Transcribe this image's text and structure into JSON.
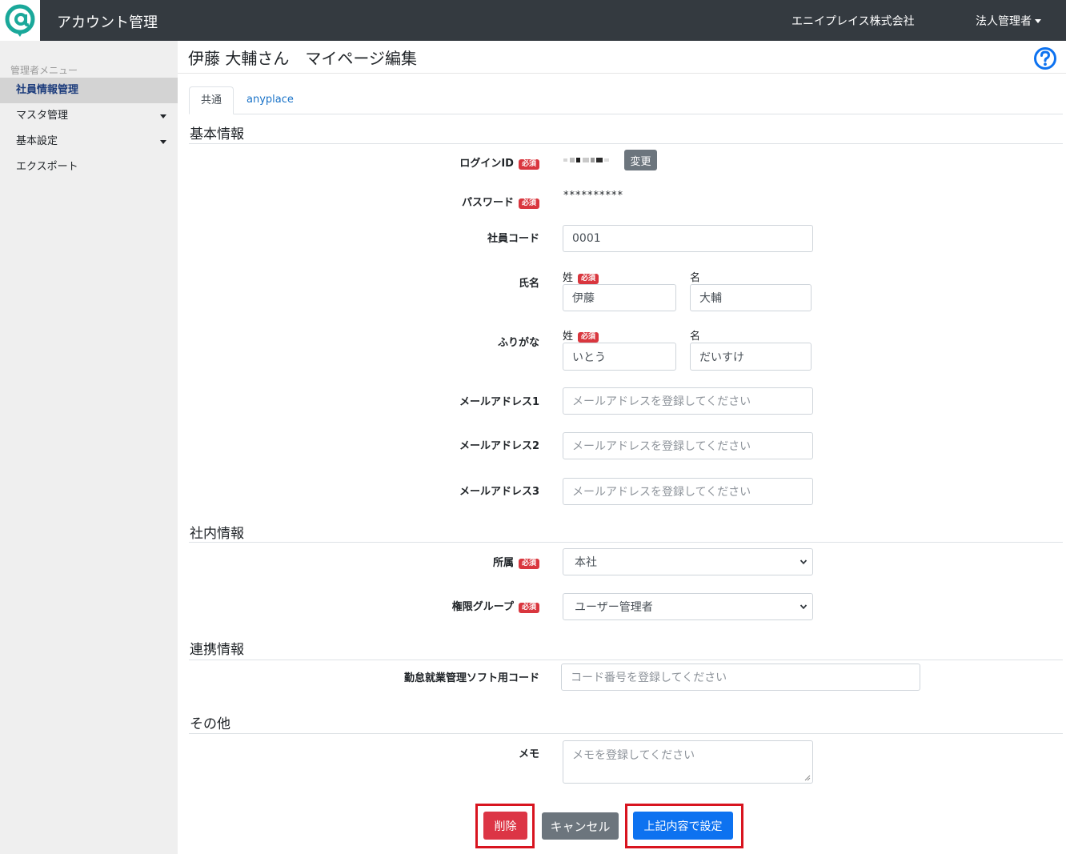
{
  "header": {
    "app_title": "アカウント管理",
    "company": "エニイプレイス株式会社",
    "user_menu": "法人管理者",
    "logo_icon": "at-sign-logo-icon",
    "accent": "#343a40"
  },
  "sidebar": {
    "heading": "管理者メニュー",
    "items": [
      {
        "label": "社員情報管理",
        "active": true
      },
      {
        "label": "マスタ管理",
        "has_dropdown": true
      },
      {
        "label": "基本設定",
        "has_dropdown": true
      },
      {
        "label": "エクスポート"
      }
    ]
  },
  "page": {
    "title": "伊藤 大輔さん　マイページ編集",
    "help_icon": "question-circle-icon"
  },
  "tabs": [
    {
      "label": "共通",
      "active": true
    },
    {
      "label": "anyplace",
      "active": false
    }
  ],
  "required_badge": "必須",
  "sections": {
    "basic": "基本情報",
    "internal": "社内情報",
    "integration": "連携情報",
    "other": "その他"
  },
  "fields": {
    "login_id": {
      "label": "ログインID",
      "change_button": "変更"
    },
    "password": {
      "label": "パスワード",
      "value": "**********"
    },
    "employee_code": {
      "label": "社員コード",
      "value": "0001"
    },
    "name": {
      "label": "氏名",
      "last_label": "姓",
      "first_label": "名",
      "last_value": "伊藤",
      "first_value": "大輔"
    },
    "furigana": {
      "label": "ふりがな",
      "last_label": "姓",
      "first_label": "名",
      "last_value": "いとう",
      "first_value": "だいすけ"
    },
    "email1": {
      "label": "メールアドレス1",
      "placeholder": "メールアドレスを登録してください"
    },
    "email2": {
      "label": "メールアドレス2",
      "placeholder": "メールアドレスを登録してください"
    },
    "email3": {
      "label": "メールアドレス3",
      "placeholder": "メールアドレスを登録してください"
    },
    "affiliation": {
      "label": "所属",
      "value": "本社"
    },
    "permission_group": {
      "label": "権限グループ",
      "value": "ユーザー管理者"
    },
    "attendance_code": {
      "label": "勤怠就業管理ソフト用コード",
      "placeholder": "コード番号を登録してください"
    },
    "memo": {
      "label": "メモ",
      "placeholder": "メモを登録してください"
    }
  },
  "buttons": {
    "delete": "削除",
    "cancel": "キャンセル",
    "submit": "上記内容で設定"
  },
  "colors": {
    "required_badge": "#d9363e",
    "primary": "#0d72f0",
    "danger": "#dc3545",
    "secondary": "#6c757d",
    "highlight_border": "#d8141f"
  }
}
